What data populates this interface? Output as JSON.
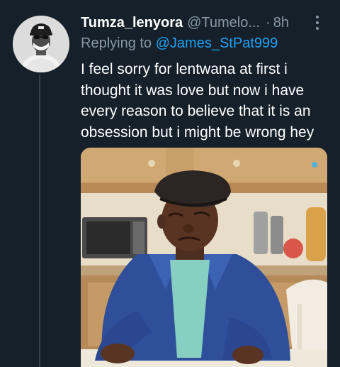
{
  "tweet": {
    "display_name": "Tumza_lenyora",
    "handle": "@Tumelo...",
    "separator": "·",
    "time": "8h",
    "replying_prefix": "Replying to",
    "replying_to": "@James_StPat999",
    "text": "I feel sorry for lentwana at first i thought it was love but now i have every reason to believe that it is an obsession but i might be wrong hey"
  },
  "icons": {
    "more": "more-vertical-icon",
    "avatar": "avatar"
  },
  "colors": {
    "background": "#15202b",
    "secondary_text": "#8899a6",
    "link": "#1da1f2",
    "thread_line": "#38444d"
  }
}
